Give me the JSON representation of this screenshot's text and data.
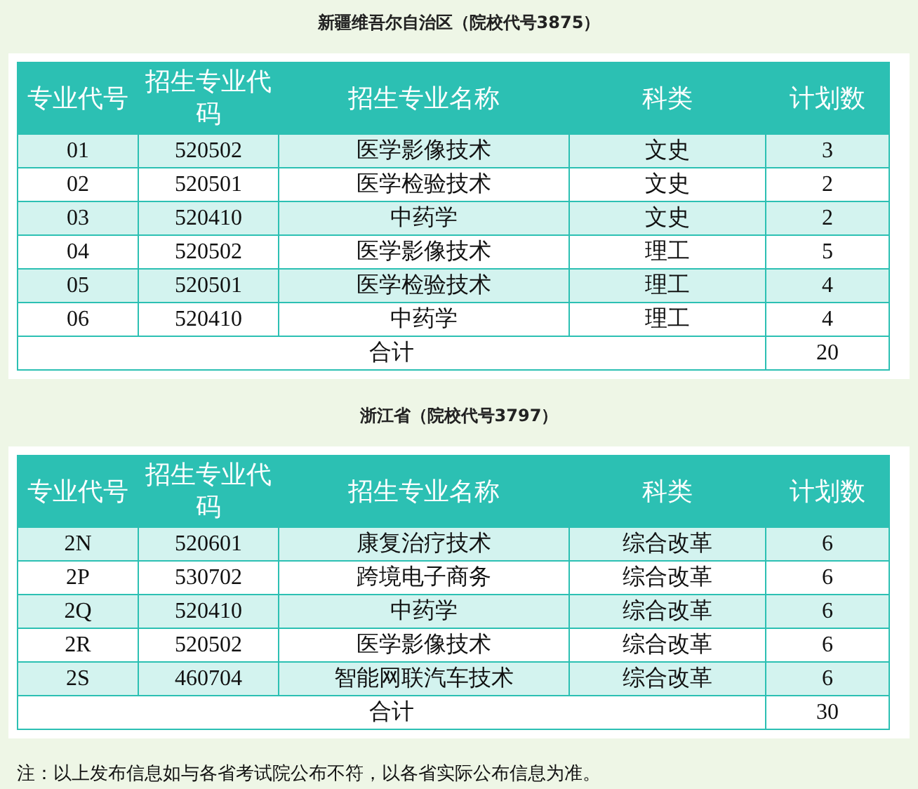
{
  "sections": [
    {
      "title": "新疆维吾尔自治区（院校代号3875）",
      "columns": [
        "专业代号",
        "招生专业代码",
        "招生专业名称",
        "科类",
        "计划数"
      ],
      "rows": [
        [
          "01",
          "520502",
          "医学影像技术",
          "文史",
          "3"
        ],
        [
          "02",
          "520501",
          "医学检验技术",
          "文史",
          "2"
        ],
        [
          "03",
          "520410",
          "中药学",
          "文史",
          "2"
        ],
        [
          "04",
          "520502",
          "医学影像技术",
          "理工",
          "5"
        ],
        [
          "05",
          "520501",
          "医学检验技术",
          "理工",
          "4"
        ],
        [
          "06",
          "520410",
          "中药学",
          "理工",
          "4"
        ]
      ],
      "total": {
        "label": "合计",
        "value": "20"
      }
    },
    {
      "title": "浙江省（院校代号3797）",
      "columns": [
        "专业代号",
        "招生专业代码",
        "招生专业名称",
        "科类",
        "计划数"
      ],
      "rows": [
        [
          "2N",
          "520601",
          "康复治疗技术",
          "综合改革",
          "6"
        ],
        [
          "2P",
          "530702",
          "跨境电子商务",
          "综合改革",
          "6"
        ],
        [
          "2Q",
          "520410",
          "中药学",
          "综合改革",
          "6"
        ],
        [
          "2R",
          "520502",
          "医学影像技术",
          "综合改革",
          "6"
        ],
        [
          "2S",
          "460704",
          "智能网联汽车技术",
          "综合改革",
          "6"
        ]
      ],
      "total": {
        "label": "合计",
        "value": "30"
      }
    }
  ],
  "note": "注：以上发布信息如与各省考试院公布不符，以各省实际公布信息为准。"
}
